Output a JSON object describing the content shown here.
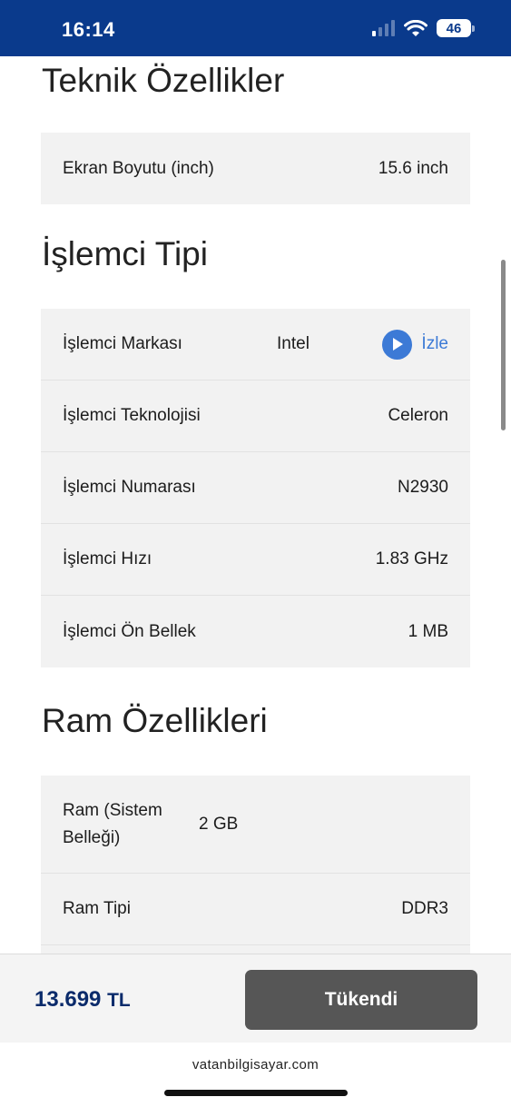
{
  "status_bar": {
    "time": "16:14",
    "battery": "46",
    "icons": [
      "cellular-signal-icon",
      "wifi-icon",
      "battery-icon"
    ]
  },
  "sections": {
    "teknik": {
      "title": "Teknik Özellikler",
      "rows": [
        {
          "label": "Ekran Boyutu (inch)",
          "value": "15.6 inch"
        }
      ]
    },
    "islemci": {
      "title": "İşlemci Tipi",
      "rows": [
        {
          "label": "İşlemci Markası",
          "value": "Intel",
          "action": "İzle"
        },
        {
          "label": "İşlemci Teknolojisi",
          "value": "Celeron"
        },
        {
          "label": "İşlemci Numarası",
          "value": "N2930"
        },
        {
          "label": "İşlemci Hızı",
          "value": "1.83 GHz"
        },
        {
          "label": "İşlemci Ön Bellek",
          "value": "1 MB"
        }
      ]
    },
    "ram": {
      "title": "Ram Özellikleri",
      "rows": [
        {
          "label": "Ram (Sistem Belleği)",
          "value": "2 GB"
        },
        {
          "label": "Ram Tipi",
          "value": "DDR3"
        }
      ]
    }
  },
  "bottom_bar": {
    "price": "13.699",
    "currency": "TL",
    "button_label": "Tükendi"
  },
  "browser": {
    "url": "vatanbilgisayar.com"
  },
  "colors": {
    "status_bar_bg": "#0a3a8c",
    "price_text": "#0b2b6b",
    "link_blue": "#3c7ad6",
    "button_bg": "#565656",
    "table_bg": "#f2f2f2"
  }
}
